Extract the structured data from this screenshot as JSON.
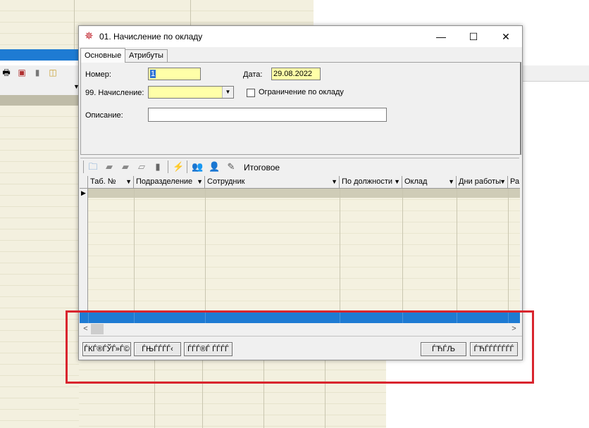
{
  "dialog": {
    "title": "01. Начисление по окладу",
    "controls": {
      "minimize": "—",
      "maximize": "☐",
      "close": "✕"
    },
    "tabs": [
      {
        "label": "Основные",
        "active": true
      },
      {
        "label": "Атрибуты",
        "active": false
      }
    ],
    "form": {
      "number_label": "Номер:",
      "number_value": "1",
      "date_label": "Дата:",
      "date_value": "29.08.2022",
      "accrual_label": "99. Начисление:",
      "accrual_value": "",
      "limit_label": "Ограничение по окладу",
      "limit_checked": false,
      "description_label": "Описание:",
      "description_value": ""
    },
    "grid_toolbar": {
      "total_label": "Итоговое",
      "icons": [
        "folder-icon",
        "folder-open-icon",
        "folder-closed-icon",
        "folders-icon",
        "document-icon",
        "lightning-icon",
        "users-icon",
        "add-user-icon",
        "magic-wand-icon"
      ]
    },
    "grid": {
      "columns": [
        {
          "label": "Таб. №"
        },
        {
          "label": "Подразделение"
        },
        {
          "label": "Сотрудник"
        },
        {
          "label": "По должности"
        },
        {
          "label": "Оклад"
        },
        {
          "label": "Дни работы"
        },
        {
          "label": "Ра"
        }
      ],
      "rows": []
    },
    "buttons": {
      "btn1": "ЃКЃ®ЃЎЃ­»Ѓ©",
      "btn2": "ЃЊЃЃЃ­Ѓ‹",
      "btn3": "ЃЃЃ®Ѓ ЃЃЃЃ",
      "ok": "ЃЋЃЉ",
      "cancel": "ЃЋЃЃЃ­Ѓ­ЃЃЃ"
    }
  },
  "colors": {
    "accent_blue": "#1e7bd3",
    "field_yellow": "#ffffa8",
    "highlight_red": "#d9252e"
  }
}
